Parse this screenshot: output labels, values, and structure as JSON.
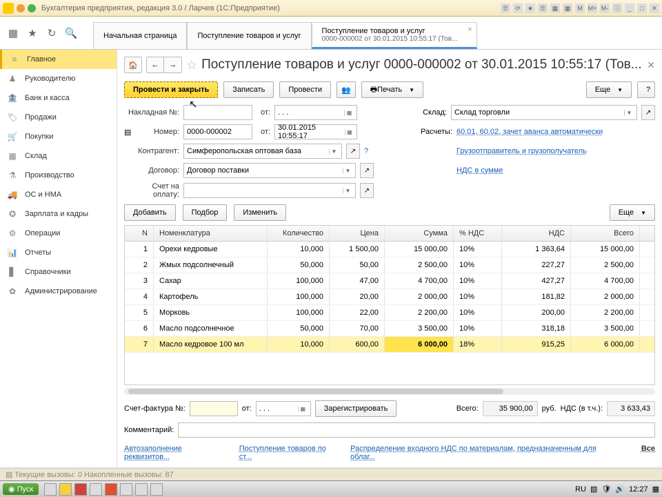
{
  "window": {
    "title": "Бухгалтерия предприятия, редакция 3.0 / Ларчев  (1С:Предприятие)"
  },
  "tabs": {
    "t0": "Начальная страница",
    "t1": "Поступление товаров и услуг",
    "t2_l1": "Поступление товаров и услуг",
    "t2_l2": "0000-000002 от 30.01.2015 10:55:17 (Тов..."
  },
  "sidebar": [
    {
      "icon": "≡",
      "label": "Главное"
    },
    {
      "icon": "♟",
      "label": "Руководителю"
    },
    {
      "icon": "🏦",
      "label": "Банк и касса"
    },
    {
      "icon": "🏷",
      "label": "Продажи"
    },
    {
      "icon": "🛒",
      "label": "Покупки"
    },
    {
      "icon": "▦",
      "label": "Склад"
    },
    {
      "icon": "⚗",
      "label": "Производство"
    },
    {
      "icon": "🚚",
      "label": "ОС и НМА"
    },
    {
      "icon": "✪",
      "label": "Зарплата и кадры"
    },
    {
      "icon": "⚙",
      "label": "Операции"
    },
    {
      "icon": "📊",
      "label": "Отчеты"
    },
    {
      "icon": "▋",
      "label": "Справочники"
    },
    {
      "icon": "✿",
      "label": "Администрирование"
    }
  ],
  "doc": {
    "title": "Поступление товаров и услуг 0000-000002 от 30.01.2015 10:55:17 (Тов...",
    "toolbar": {
      "post_close": "Провести и закрыть",
      "save": "Записать",
      "post": "Провести",
      "print": "Печать",
      "more": "Еще"
    },
    "form": {
      "invoice_lbl": "Накладная №:",
      "from_lbl": "от:",
      "number_lbl": "Номер:",
      "number": "0000-000002",
      "date": "30.01.2015 10:55:17",
      "counterparty_lbl": "Контрагент:",
      "counterparty": "Симферопольская оптовая база",
      "contract_lbl": "Договор:",
      "contract": "Договор поставки",
      "bill_lbl": "Счет на оплату:",
      "warehouse_lbl": "Склад:",
      "warehouse": "Склад торговли",
      "calc_lbl": "Расчеты:",
      "calc_link": "60.01, 60.02, зачет аванса автоматически",
      "shipper_link": "Грузоотправитель и грузополучатель",
      "vat_link": "НДС в сумме",
      "dot_date": ". . ."
    },
    "tblbtn": {
      "add": "Добавить",
      "pick": "Подбор",
      "edit": "Изменить",
      "more": "Еще"
    },
    "head": {
      "n": "N",
      "name": "Номенклатура",
      "qty": "Количество",
      "price": "Цена",
      "sum": "Сумма",
      "vat": "% НДС",
      "vatamt": "НДС",
      "total": "Всего"
    },
    "rows": [
      {
        "n": "1",
        "name": "Орехи кедровые",
        "qty": "10,000",
        "price": "1 500,00",
        "sum": "15 000,00",
        "vat": "10%",
        "vatamt": "1 363,64",
        "total": "15 000,00"
      },
      {
        "n": "2",
        "name": "Жмых подсолнечный",
        "qty": "50,000",
        "price": "50,00",
        "sum": "2 500,00",
        "vat": "10%",
        "vatamt": "227,27",
        "total": "2 500,00"
      },
      {
        "n": "3",
        "name": "Сахар",
        "qty": "100,000",
        "price": "47,00",
        "sum": "4 700,00",
        "vat": "10%",
        "vatamt": "427,27",
        "total": "4 700,00"
      },
      {
        "n": "4",
        "name": "Картофель",
        "qty": "100,000",
        "price": "20,00",
        "sum": "2 000,00",
        "vat": "10%",
        "vatamt": "181,82",
        "total": "2 000,00"
      },
      {
        "n": "5",
        "name": "Морковь",
        "qty": "100,000",
        "price": "22,00",
        "sum": "2 200,00",
        "vat": "10%",
        "vatamt": "200,00",
        "total": "2 200,00"
      },
      {
        "n": "6",
        "name": "Масло подсолнечное",
        "qty": "50,000",
        "price": "70,00",
        "sum": "3 500,00",
        "vat": "10%",
        "vatamt": "318,18",
        "total": "3 500,00"
      },
      {
        "n": "7",
        "name": "Масло кедровое 100 мл",
        "qty": "10,000",
        "price": "600,00",
        "sum": "6 000,00",
        "vat": "18%",
        "vatamt": "915,25",
        "total": "6 000,00"
      }
    ],
    "footer": {
      "sf_lbl": "Счет-фактура №:",
      "from": "от:",
      "register": "Зарегистрировать",
      "total_lbl": "Всего:",
      "total": "35 900,00",
      "cur": "руб.",
      "vat_lbl": "НДС (в т.ч.):",
      "vat": "3 633,43",
      "comment_lbl": "Комментарий:",
      "link1": "Автозаполнение реквизитов...",
      "link2": "Поступление товаров по ст...",
      "link3": "Распределение входного НДС по материалам, предназначенным для облаг...",
      "all": "Все"
    }
  },
  "status": {
    "line": "Текущие вызовы: 0  Накопленные вызовы: 87"
  },
  "taskbar": {
    "start": "Пуск",
    "lang": "RU",
    "time": "12:27"
  }
}
